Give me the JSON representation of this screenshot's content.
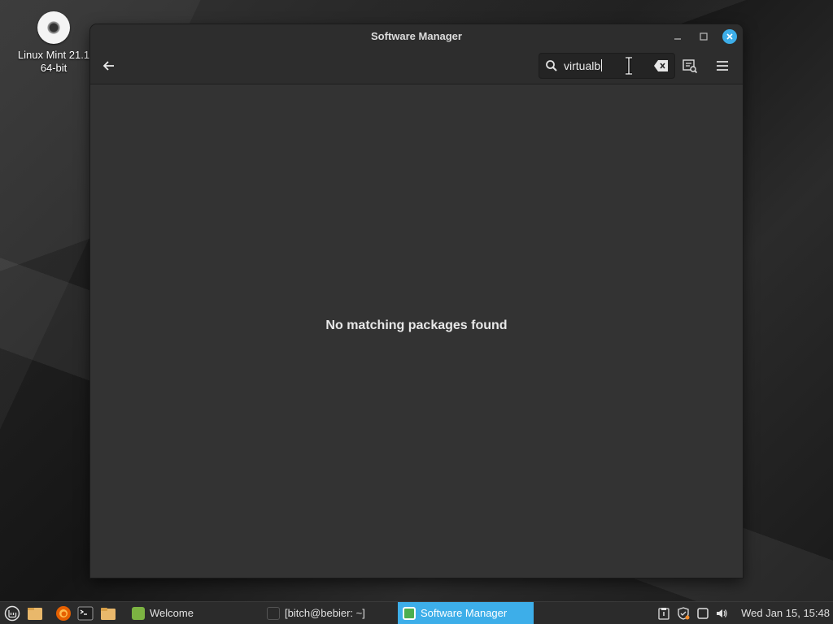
{
  "desktop": {
    "icon_label": "Linux Mint 21.1\n64-bit"
  },
  "window": {
    "title": "Software Manager",
    "search": {
      "value": "virtualb"
    },
    "empty_message": "No matching packages found"
  },
  "taskbar": {
    "tasks": [
      {
        "label": "Welcome"
      },
      {
        "label": "[bitch@bebier: ~]"
      },
      {
        "label": "Software Manager"
      }
    ],
    "clock": "Wed Jan 15, 15:48",
    "accent_color": "#3daee9"
  }
}
